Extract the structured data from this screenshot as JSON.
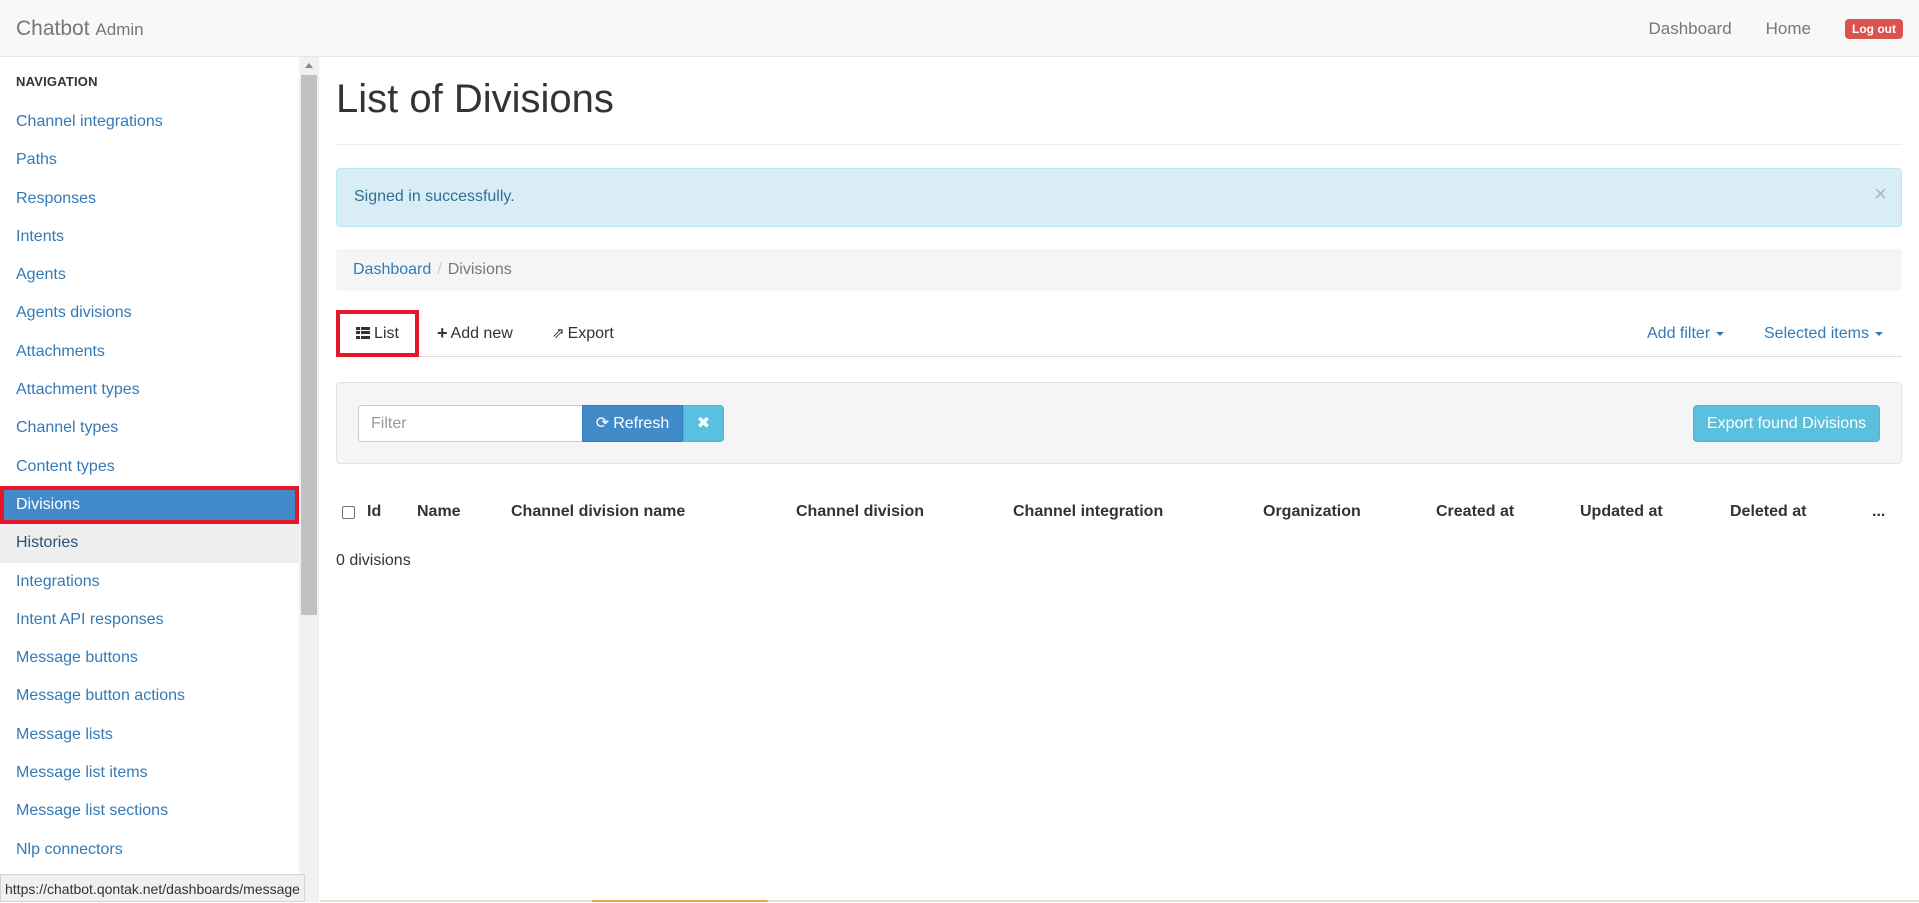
{
  "navbar": {
    "brand": "Chatbot",
    "brand_sub": "Admin",
    "links": [
      "Dashboard",
      "Home"
    ],
    "logout": "Log out",
    "logout_color": "#d9534f"
  },
  "sidebar": {
    "header": "NAVIGATION",
    "items": [
      {
        "label": "Channel integrations"
      },
      {
        "label": "Paths"
      },
      {
        "label": "Responses"
      },
      {
        "label": "Intents"
      },
      {
        "label": "Agents"
      },
      {
        "label": "Agents divisions"
      },
      {
        "label": "Attachments"
      },
      {
        "label": "Attachment types"
      },
      {
        "label": "Channel types"
      },
      {
        "label": "Content types"
      },
      {
        "label": "Divisions",
        "active": true
      },
      {
        "label": "Histories",
        "hover": true
      },
      {
        "label": "Integrations"
      },
      {
        "label": "Intent API responses"
      },
      {
        "label": "Message buttons"
      },
      {
        "label": "Message button actions"
      },
      {
        "label": "Message lists"
      },
      {
        "label": "Message list items"
      },
      {
        "label": "Message list sections"
      },
      {
        "label": "Nlp connectors"
      }
    ]
  },
  "statusbar": {
    "url": "https://chatbot.qontak.net/dashboards/message"
  },
  "main": {
    "title": "List of Divisions",
    "alert": "Signed in successfully.",
    "alert_close": "×",
    "breadcrumb": {
      "link": "Dashboard",
      "separator": "/",
      "active": "Divisions"
    },
    "tabs": {
      "list": "List",
      "add_new": "Add new",
      "export": "Export",
      "add_filter": "Add filter",
      "selected_items": "Selected items"
    },
    "filter": {
      "placeholder": "Filter",
      "refresh": "Refresh",
      "clear": "✖",
      "export_found": "Export found Divisions"
    },
    "table": {
      "headers": [
        "Id",
        "Name",
        "Channel division name",
        "Channel division",
        "Channel integration",
        "Organization",
        "Created at",
        "Updated at",
        "Deleted at",
        "..."
      ]
    },
    "count": "0 divisions"
  },
  "colors": {
    "primary": "#428bca",
    "info": "#5bc0de",
    "link": "#337ab7",
    "highlight": "#e5162a",
    "alert_bg": "#d9edf7",
    "alert_text": "#31708f"
  }
}
